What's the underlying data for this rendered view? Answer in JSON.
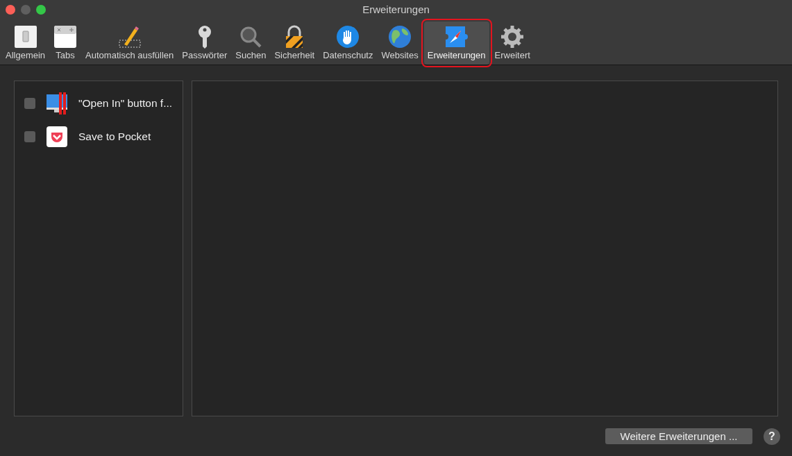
{
  "window": {
    "title": "Erweiterungen"
  },
  "tabs": [
    {
      "label": "Allgemein",
      "selected": false,
      "annotated": false
    },
    {
      "label": "Tabs",
      "selected": false,
      "annotated": false
    },
    {
      "label": "Automatisch ausfüllen",
      "selected": false,
      "annotated": false
    },
    {
      "label": "Passwörter",
      "selected": false,
      "annotated": false
    },
    {
      "label": "Suchen",
      "selected": false,
      "annotated": false
    },
    {
      "label": "Sicherheit",
      "selected": false,
      "annotated": false
    },
    {
      "label": "Datenschutz",
      "selected": false,
      "annotated": false
    },
    {
      "label": "Websites",
      "selected": false,
      "annotated": false
    },
    {
      "label": "Erweiterungen",
      "selected": true,
      "annotated": true
    },
    {
      "label": "Erweitert",
      "selected": false,
      "annotated": false
    }
  ],
  "extensions": [
    {
      "name": "\"Open In\" button f...",
      "checked": false
    },
    {
      "name": "Save to Pocket",
      "checked": false
    }
  ],
  "more_button": "Weitere Erweiterungen ...",
  "help_button": "?"
}
